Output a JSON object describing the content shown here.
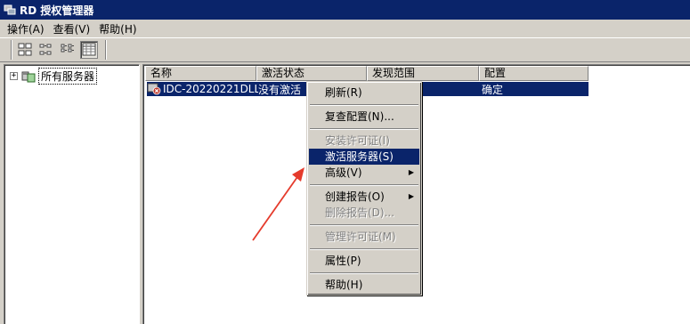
{
  "window": {
    "title": "RD 授权管理器"
  },
  "menubar": {
    "items": [
      "操作(A)",
      "查看(V)",
      "帮助(H)"
    ]
  },
  "toolbar": {
    "buttons": [
      "large-icons-icon",
      "small-icons-icon",
      "list-view-icon",
      "details-view-icon"
    ],
    "pressed_index": 3
  },
  "tree": {
    "expander": "+",
    "root_label": "所有服务器"
  },
  "list": {
    "columns": [
      "名称",
      "激活状态",
      "发现范围",
      "配置"
    ],
    "rows": [
      {
        "name": "IDC-20220221DLL",
        "status": "没有激活",
        "scope": "",
        "config": "确定"
      }
    ]
  },
  "context_menu": {
    "items": [
      {
        "label": "刷新(R)",
        "disabled": false,
        "submenu": false
      },
      {
        "separator": true
      },
      {
        "label": "复查配置(N)...",
        "disabled": false,
        "submenu": false
      },
      {
        "separator": true
      },
      {
        "label": "安装许可证(I)",
        "disabled": true,
        "submenu": false
      },
      {
        "label": "激活服务器(S)",
        "disabled": false,
        "submenu": false,
        "selected": true
      },
      {
        "label": "高级(V)",
        "disabled": false,
        "submenu": true
      },
      {
        "separator": true
      },
      {
        "label": "创建报告(O)",
        "disabled": false,
        "submenu": true
      },
      {
        "label": "删除报告(D)...",
        "disabled": true,
        "submenu": false
      },
      {
        "separator": true
      },
      {
        "label": "管理许可证(M)",
        "disabled": true,
        "submenu": false
      },
      {
        "separator": true
      },
      {
        "label": "属性(P)",
        "disabled": false,
        "submenu": false
      },
      {
        "separator": true
      },
      {
        "label": "帮助(H)",
        "disabled": false,
        "submenu": false
      }
    ]
  },
  "colors": {
    "titlebar": "#0a246a",
    "selection": "#0a246a",
    "arrow": "#e53b2c"
  }
}
